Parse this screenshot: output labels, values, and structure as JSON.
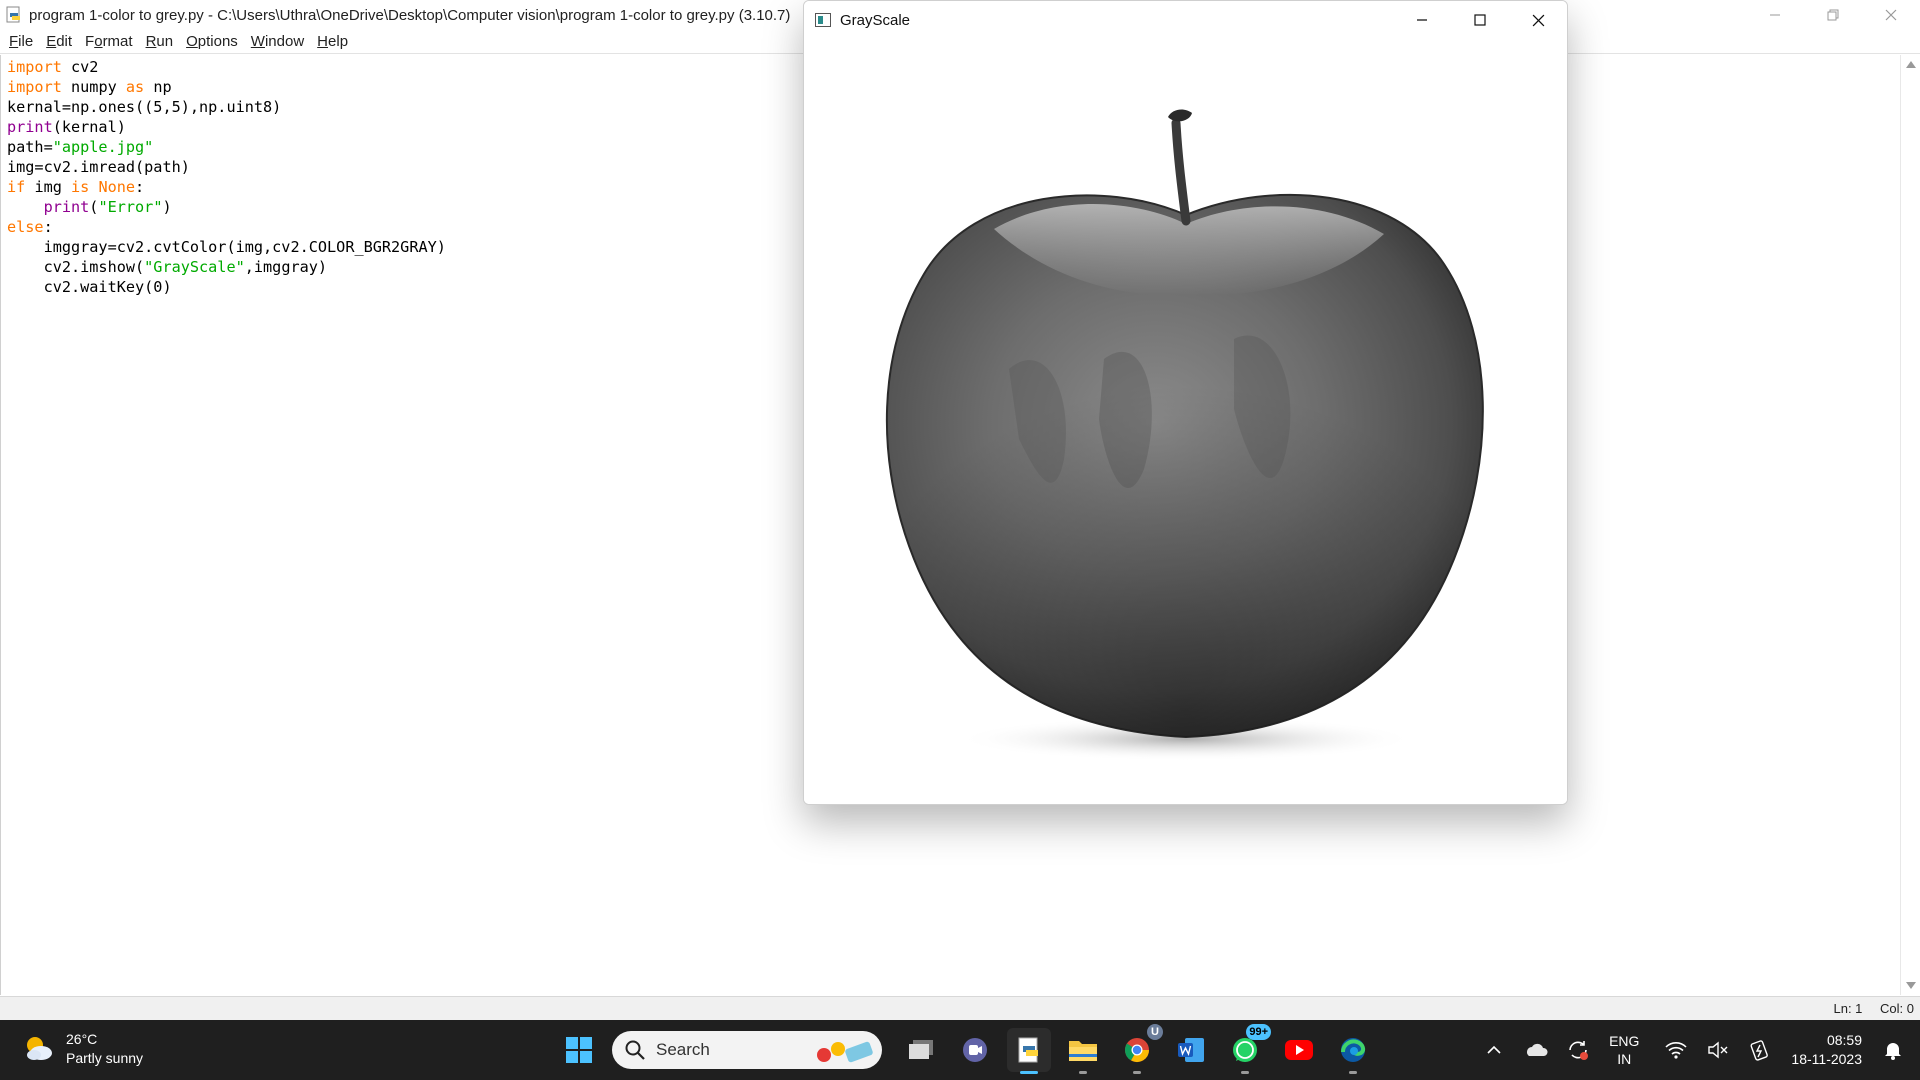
{
  "idle": {
    "title": "program 1-color to grey.py - C:\\Users\\Uthra\\OneDrive\\Desktop\\Computer vision\\program 1-color to grey.py (3.10.7)",
    "menu": [
      {
        "first": "F",
        "rest": "ile"
      },
      {
        "first": "E",
        "rest": "dit"
      },
      {
        "first": "F",
        "rest": "ormat",
        "underline_index": 1
      },
      {
        "first": "R",
        "rest": "un"
      },
      {
        "first": "O",
        "rest": "ptions"
      },
      {
        "first": "W",
        "rest": "indow"
      },
      {
        "first": "H",
        "rest": "elp"
      }
    ],
    "status": {
      "line": "Ln: 1",
      "col": "Col: 0"
    }
  },
  "code": [
    [
      {
        "t": "import",
        "c": "kw"
      },
      {
        "t": " cv2"
      }
    ],
    [
      {
        "t": "import",
        "c": "kw"
      },
      {
        "t": " numpy "
      },
      {
        "t": "as",
        "c": "kw"
      },
      {
        "t": " np"
      }
    ],
    [
      {
        "t": "kernal=np.ones((5,5),np.uint8)"
      }
    ],
    [
      {
        "t": "print",
        "c": "bi"
      },
      {
        "t": "(kernal)"
      }
    ],
    [
      {
        "t": "path="
      },
      {
        "t": "\"apple.jpg\"",
        "c": "st"
      }
    ],
    [
      {
        "t": "img=cv2.imread(path)"
      }
    ],
    [
      {
        "t": "if",
        "c": "kw"
      },
      {
        "t": " img "
      },
      {
        "t": "is",
        "c": "kw"
      },
      {
        "t": " "
      },
      {
        "t": "None",
        "c": "kw"
      },
      {
        "t": ":"
      }
    ],
    [
      {
        "t": "    "
      },
      {
        "t": "print",
        "c": "bi"
      },
      {
        "t": "("
      },
      {
        "t": "\"Error\"",
        "c": "st"
      },
      {
        "t": ")"
      }
    ],
    [
      {
        "t": "else",
        "c": "kw"
      },
      {
        "t": ":"
      }
    ],
    [
      {
        "t": "    imggray=cv2.cvtColor(img,cv2.COLOR_BGR2GRAY)"
      }
    ],
    [
      {
        "t": "    cv2.imshow("
      },
      {
        "t": "\"GrayScale\"",
        "c": "st"
      },
      {
        "t": ",imggray)"
      }
    ],
    [
      {
        "t": "    cv2.waitKey(0)"
      }
    ]
  ],
  "grayscale_window": {
    "title": "GrayScale"
  },
  "taskbar": {
    "weather": {
      "temp": "26°C",
      "desc": "Partly sunny",
      "icon": "partly-sunny-icon"
    },
    "search_label": "Search",
    "apps": [
      {
        "name": "task-view-icon"
      },
      {
        "name": "teams-icon"
      },
      {
        "name": "python-idle-icon",
        "active": true
      },
      {
        "name": "file-explorer-icon"
      },
      {
        "name": "chrome-icon",
        "badge_text": "U"
      },
      {
        "name": "word-icon"
      },
      {
        "name": "whatsapp-icon",
        "badge": "99+"
      },
      {
        "name": "youtube-icon"
      },
      {
        "name": "edge-icon"
      }
    ],
    "lang": {
      "line1": "ENG",
      "line2": "IN"
    },
    "clock": {
      "time": "08:59",
      "date": "18-11-2023"
    },
    "colors": {
      "taskbar_bg": "#1f1f1f",
      "accent": "#4cc2ff"
    }
  }
}
